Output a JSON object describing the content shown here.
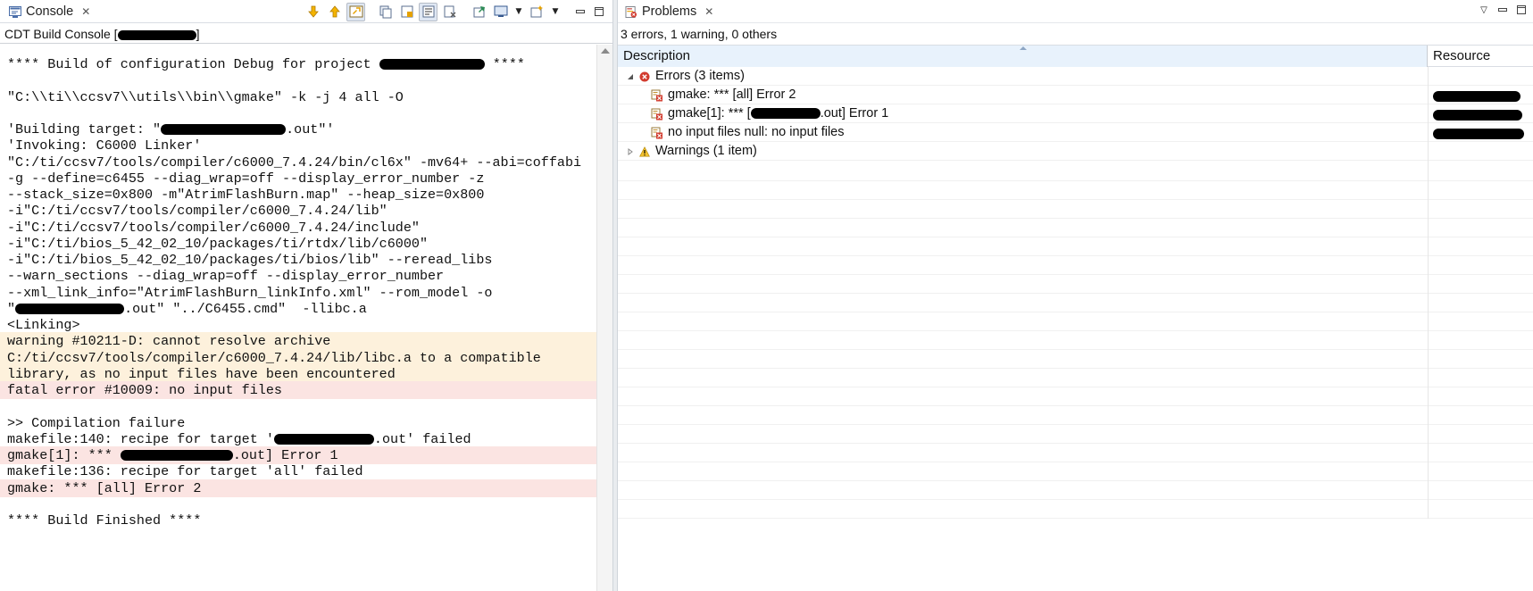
{
  "console": {
    "tab_label": "Console",
    "title_prefix": "CDT Build Console [",
    "title_suffix": "]",
    "lines": [
      {
        "kind": "normal",
        "parts": [
          "**** Build of configuration Debug for project ",
          "",
          " ****"
        ]
      },
      {
        "kind": "normal",
        "parts": [
          "\"C:\\\\ti\\\\ccsv7\\\\utils\\\\bin\\\\gmake\" -k -j 4 all -O"
        ]
      },
      {
        "kind": "normal",
        "parts": [
          "'Building target: \"",
          "",
          ".out\"'"
        ]
      },
      {
        "kind": "normal",
        "parts": [
          "'Invoking: C6000 Linker'"
        ]
      },
      {
        "kind": "normal",
        "parts": [
          "\"C:/ti/ccsv7/tools/compiler/c6000_7.4.24/bin/cl6x\" -mv64+ --abi=coffabi"
        ]
      },
      {
        "kind": "normal",
        "parts": [
          "-g --define=c6455 --diag_wrap=off --display_error_number -z"
        ]
      },
      {
        "kind": "normal",
        "parts": [
          "--stack_size=0x800 -m\"AtrimFlashBurn.map\" --heap_size=0x800"
        ]
      },
      {
        "kind": "normal",
        "parts": [
          "-i\"C:/ti/ccsv7/tools/compiler/c6000_7.4.24/lib\""
        ]
      },
      {
        "kind": "normal",
        "parts": [
          "-i\"C:/ti/ccsv7/tools/compiler/c6000_7.4.24/include\""
        ]
      },
      {
        "kind": "normal",
        "parts": [
          "-i\"C:/ti/bios_5_42_02_10/packages/ti/rtdx/lib/c6000\""
        ]
      },
      {
        "kind": "normal",
        "parts": [
          "-i\"C:/ti/bios_5_42_02_10/packages/ti/bios/lib\" --reread_libs"
        ]
      },
      {
        "kind": "normal",
        "parts": [
          "--warn_sections --diag_wrap=off --display_error_number"
        ]
      },
      {
        "kind": "normal",
        "parts": [
          "--xml_link_info=\"AtrimFlashBurn_linkInfo.xml\" --rom_model -o"
        ]
      },
      {
        "kind": "normal",
        "parts": [
          "\"",
          "",
          ".out\" \"../C6455.cmd\"  -llibc.a"
        ]
      },
      {
        "kind": "normal",
        "parts": [
          "<Linking>"
        ]
      },
      {
        "kind": "warn",
        "parts": [
          "warning #10211-D: cannot resolve archive"
        ]
      },
      {
        "kind": "warn",
        "parts": [
          "C:/ti/ccsv7/tools/compiler/c6000_7.4.24/lib/libc.a to a compatible"
        ]
      },
      {
        "kind": "warn",
        "parts": [
          "library, as no input files have been encountered"
        ]
      },
      {
        "kind": "err",
        "parts": [
          "fatal error #10009: no input files"
        ]
      },
      {
        "kind": "normal",
        "parts": [
          ">> Compilation failure"
        ]
      },
      {
        "kind": "normal",
        "parts": [
          "makefile:140: recipe for target '",
          "",
          ".out' failed"
        ]
      },
      {
        "kind": "err",
        "parts": [
          "gmake[1]: *** ",
          "",
          ".out] Error 1"
        ]
      },
      {
        "kind": "normal",
        "parts": [
          "makefile:136: recipe for target 'all' failed"
        ]
      },
      {
        "kind": "err",
        "parts": [
          "gmake: *** [all] Error 2"
        ]
      },
      {
        "kind": "normal",
        "parts": [
          "**** Build Finished ****"
        ]
      }
    ]
  },
  "problems": {
    "tab_label": "Problems",
    "summary": "3 errors, 1 warning, 0 others",
    "columns": {
      "description": "Description",
      "resource": "Resource"
    },
    "rows": [
      {
        "level": 0,
        "type": "errors-group",
        "expanded": true,
        "text": "Errors (3 items)"
      },
      {
        "level": 1,
        "type": "error",
        "text": "gmake: *** [all] Error 2"
      },
      {
        "level": 1,
        "type": "error",
        "text_prefix": "gmake[1]: *** [",
        "text_suffix": ".out] Error 1"
      },
      {
        "level": 1,
        "type": "error",
        "text": "no input files null: no input files"
      },
      {
        "level": 0,
        "type": "warnings-group",
        "expanded": false,
        "text": "Warnings (1 item)"
      }
    ]
  },
  "colors": {
    "warn_line_bg": "#fdf1dc",
    "error_line_bg": "#fbe4e2",
    "header_selected_bg": "#e8f2fc",
    "error_red": "#d23b2e",
    "warning_yellow": "#f2c12e"
  }
}
